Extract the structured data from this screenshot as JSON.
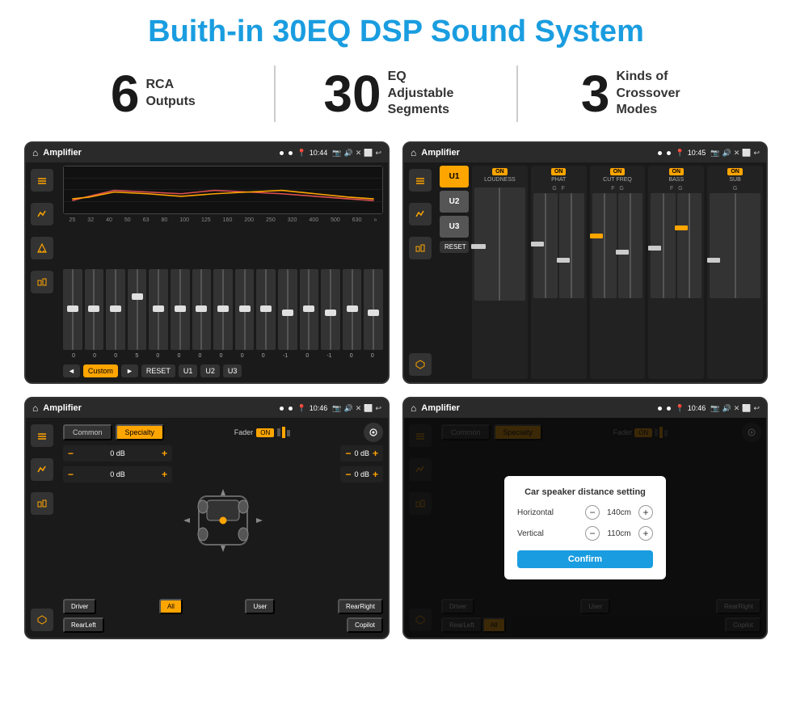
{
  "title": "Buith-in 30EQ DSP Sound System",
  "stats": [
    {
      "number": "6",
      "label": "RCA\nOutputs"
    },
    {
      "number": "30",
      "label": "EQ Adjustable\nSegments"
    },
    {
      "number": "3",
      "label": "Kinds of\nCrossover Modes"
    }
  ],
  "colors": {
    "title": "#1a9de0",
    "orange": "#ffa500",
    "dark": "#1a1a1a",
    "bg": "#ffffff"
  },
  "screens": [
    {
      "id": "screen-eq",
      "header_title": "Amplifier",
      "time": "10:44",
      "type": "eq"
    },
    {
      "id": "screen-amp",
      "header_title": "Amplifier",
      "time": "10:45",
      "type": "amplifier"
    },
    {
      "id": "screen-fader",
      "header_title": "Amplifier",
      "time": "10:46",
      "type": "fader"
    },
    {
      "id": "screen-dialog",
      "header_title": "Amplifier",
      "time": "10:46",
      "type": "dialog"
    }
  ],
  "eq": {
    "frequencies": [
      "25",
      "32",
      "40",
      "50",
      "63",
      "80",
      "100",
      "125",
      "160",
      "200",
      "250",
      "320",
      "400",
      "500",
      "630"
    ],
    "values": [
      "0",
      "0",
      "0",
      "5",
      "0",
      "0",
      "0",
      "0",
      "0",
      "0",
      "-1",
      "0",
      "-1"
    ],
    "buttons": [
      "Custom",
      "RESET",
      "U1",
      "U2",
      "U3"
    ]
  },
  "amplifier": {
    "u_buttons": [
      "U1",
      "U2",
      "U3"
    ],
    "channels": [
      {
        "on": true,
        "label": "LOUDNESS"
      },
      {
        "on": true,
        "label": "PHAT"
      },
      {
        "on": true,
        "label": "CUT FREQ"
      },
      {
        "on": true,
        "label": "BASS"
      },
      {
        "on": true,
        "label": "SUB"
      }
    ]
  },
  "fader": {
    "tabs": [
      "Common",
      "Specialty"
    ],
    "active_tab": "Specialty",
    "fader_label": "Fader",
    "on_label": "ON",
    "db_controls": [
      "0 dB",
      "0 dB",
      "0 dB",
      "0 dB"
    ],
    "bottom_buttons": [
      "Driver",
      "All",
      "User",
      "RearRight",
      "RearLeft",
      "Copilot"
    ]
  },
  "dialog": {
    "title": "Car speaker distance setting",
    "horizontal_label": "Horizontal",
    "horizontal_value": "140cm",
    "vertical_label": "Vertical",
    "vertical_value": "110cm",
    "confirm_label": "Confirm"
  }
}
